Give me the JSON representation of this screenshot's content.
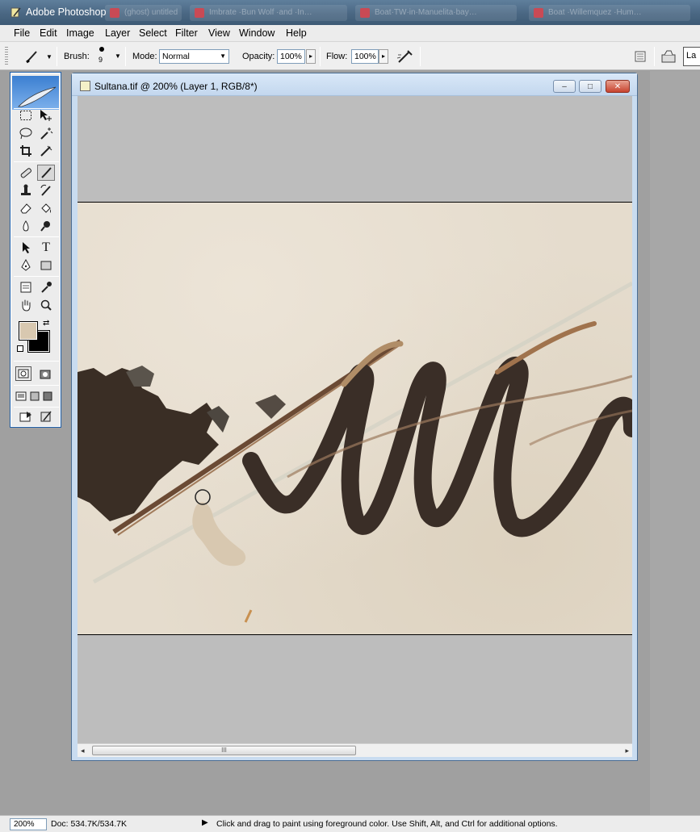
{
  "app": {
    "title": "Adobe Photoshop",
    "background_tabs": [
      "(ghost) untitled",
      "Imbrate ·Bun Wolf ·and ·In…",
      "Boat·TW·in·Manuelita·bay…",
      "Boat ·Willemquez ·Hum…"
    ]
  },
  "menu": {
    "items": [
      "File",
      "Edit",
      "Image",
      "Layer",
      "Select",
      "Filter",
      "View",
      "Window",
      "Help"
    ]
  },
  "options": {
    "brush_label": "Brush:",
    "brush_size": "9",
    "mode_label": "Mode:",
    "mode_value": "Normal",
    "opacity_label": "Opacity:",
    "opacity_value": "100%",
    "flow_label": "Flow:",
    "flow_value": "100%",
    "right_tab_partial": "La"
  },
  "toolbox": {
    "tools": [
      "marquee-tool",
      "move-tool",
      "lasso-tool",
      "magic-wand-tool",
      "crop-tool",
      "slice-tool",
      "healing-brush-tool",
      "brush-tool",
      "clone-stamp-tool",
      "history-brush-tool",
      "eraser-tool",
      "paint-bucket-tool",
      "blur-tool",
      "dodge-tool",
      "path-selection-tool",
      "type-tool",
      "pen-tool",
      "rectangle-tool",
      "notes-tool",
      "eyedropper-tool",
      "hand-tool",
      "zoom-tool"
    ],
    "type_tool_glyph": "T",
    "foreground_color": "#d8c8b0",
    "background_color": "#000000"
  },
  "document": {
    "title": "Sultana.tif @ 200% (Layer 1, RGB/8*)",
    "minimize": "–",
    "maximize": "□",
    "close": "✕",
    "scroll_thumb_grip": "III"
  },
  "status": {
    "zoom": "200%",
    "doc_size": "Doc: 534.7K/534.7K",
    "hint": "Click and drag to paint using foreground color.  Use Shift, Alt, and Ctrl for additional options."
  }
}
